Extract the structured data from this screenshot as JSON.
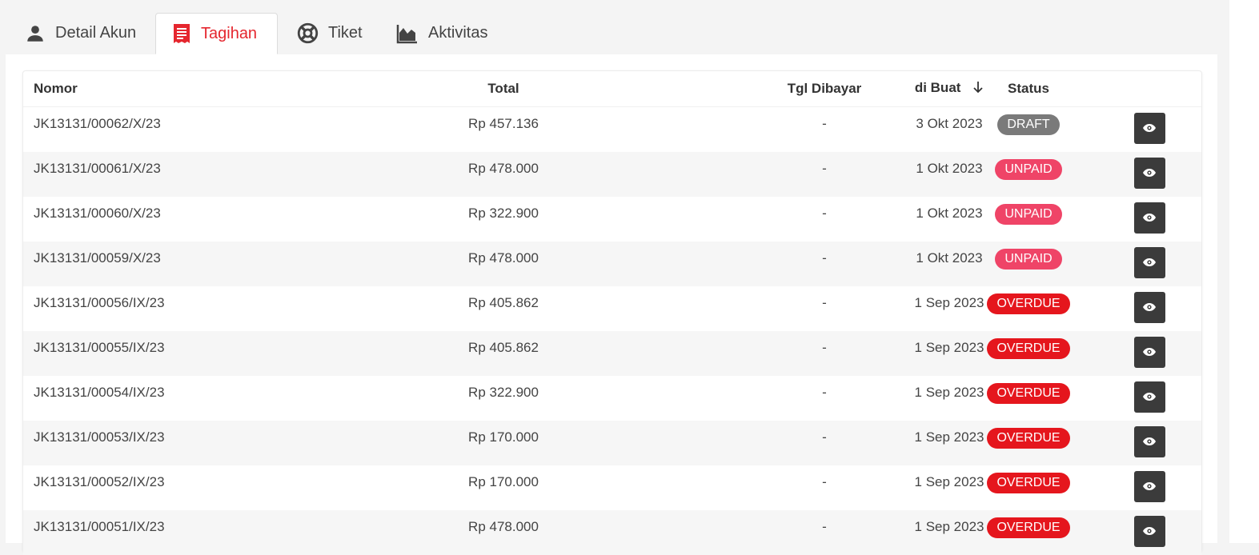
{
  "tabs": [
    {
      "label": "Detail Akun",
      "icon": "user-icon",
      "active": false
    },
    {
      "label": "Tagihan",
      "icon": "invoice-icon",
      "active": true
    },
    {
      "label": "Tiket",
      "icon": "lifebuoy-icon",
      "active": false
    },
    {
      "label": "Aktivitas",
      "icon": "area-chart-icon",
      "active": false
    }
  ],
  "colors": {
    "accent": "#e5262e",
    "draft": "#7a7a7a",
    "unpaid": "#ef4467",
    "overdue": "#e5161d",
    "view_button": "#3b3b3b"
  },
  "table": {
    "headers": {
      "nomor": "Nomor",
      "total": "Total",
      "tgl_dibayar": "Tgl Dibayar",
      "di_buat": "di Buat",
      "status": "Status"
    },
    "sort": {
      "column": "di Buat",
      "direction": "descending",
      "icon": "arrow-down-icon"
    },
    "rows": [
      {
        "nomor": "JK13131/00062/X/23",
        "total": "Rp 457.136",
        "tgl_dibayar": "-",
        "di_buat": "3 Okt 2023",
        "status": "DRAFT"
      },
      {
        "nomor": "JK13131/00061/X/23",
        "total": "Rp 478.000",
        "tgl_dibayar": "-",
        "di_buat": "1 Okt 2023",
        "status": "UNPAID"
      },
      {
        "nomor": "JK13131/00060/X/23",
        "total": "Rp 322.900",
        "tgl_dibayar": "-",
        "di_buat": "1 Okt 2023",
        "status": "UNPAID"
      },
      {
        "nomor": "JK13131/00059/X/23",
        "total": "Rp 478.000",
        "tgl_dibayar": "-",
        "di_buat": "1 Okt 2023",
        "status": "UNPAID"
      },
      {
        "nomor": "JK13131/00056/IX/23",
        "total": "Rp 405.862",
        "tgl_dibayar": "-",
        "di_buat": "1 Sep 2023",
        "status": "OVERDUE"
      },
      {
        "nomor": "JK13131/00055/IX/23",
        "total": "Rp 405.862",
        "tgl_dibayar": "-",
        "di_buat": "1 Sep 2023",
        "status": "OVERDUE"
      },
      {
        "nomor": "JK13131/00054/IX/23",
        "total": "Rp 322.900",
        "tgl_dibayar": "-",
        "di_buat": "1 Sep 2023",
        "status": "OVERDUE"
      },
      {
        "nomor": "JK13131/00053/IX/23",
        "total": "Rp 170.000",
        "tgl_dibayar": "-",
        "di_buat": "1 Sep 2023",
        "status": "OVERDUE"
      },
      {
        "nomor": "JK13131/00052/IX/23",
        "total": "Rp 170.000",
        "tgl_dibayar": "-",
        "di_buat": "1 Sep 2023",
        "status": "OVERDUE"
      },
      {
        "nomor": "JK13131/00051/IX/23",
        "total": "Rp 478.000",
        "tgl_dibayar": "-",
        "di_buat": "1 Sep 2023",
        "status": "OVERDUE"
      }
    ],
    "row_action_icon": "eye-icon"
  }
}
